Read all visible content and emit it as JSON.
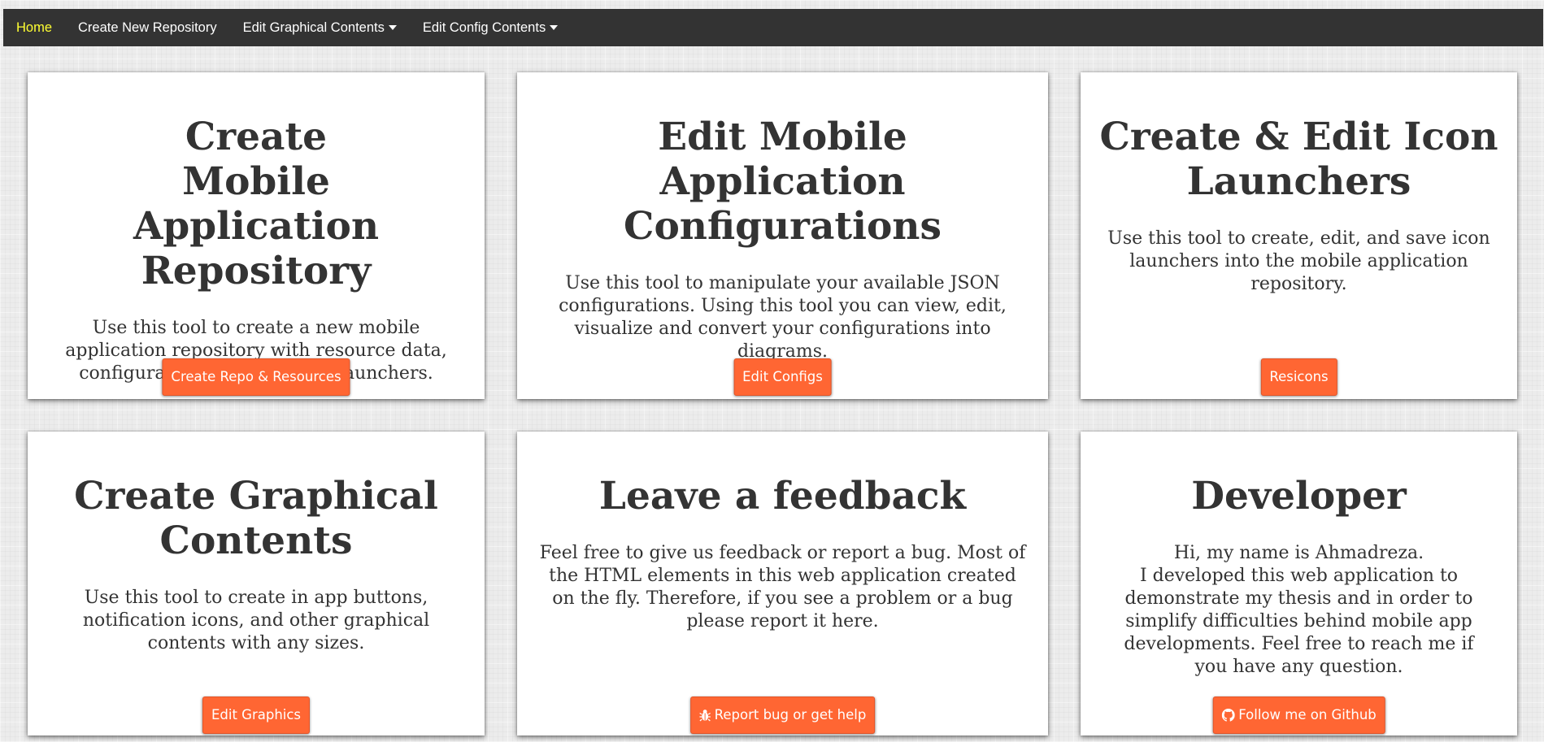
{
  "navbar": {
    "items": [
      {
        "label": "Home"
      },
      {
        "label": "Create New Repository"
      },
      {
        "label": "Edit Graphical Contents"
      },
      {
        "label": "Edit Config Contents"
      }
    ]
  },
  "cards": [
    {
      "title": "Create Mobile Application Repository",
      "description": "Use this tool to create a new mobile application repository with resource data, configuration files, and icon launchers.",
      "button": "Create Repo & Resources"
    },
    {
      "title": "Edit Mobile Application Configurations",
      "description": "Use this tool to manipulate your available JSON configurations. Using this tool you can view, edit, visualize and convert your configurations into diagrams.",
      "button": "Edit Configs"
    },
    {
      "title": "Create & Edit Icon Launchers",
      "description": "Use this tool to create, edit, and save icon launchers into the mobile application repository.",
      "button": "Resicons"
    },
    {
      "title": "Create Graphical Contents",
      "description": "Use this tool to create in app buttons, notification icons, and other graphical contents with any sizes.",
      "button": "Edit Graphics"
    },
    {
      "title": "Leave a feedback",
      "description": "Feel free to give us feedback or report a bug. Most of the HTML elements in this web application created on the fly. Therefore, if you see a problem or a bug please report it here.",
      "button": "Report bug or get help",
      "button_icon": "bug-icon"
    },
    {
      "title": "Developer",
      "greeting": "Hi, my name is Ahmadreza.",
      "description": "I developed this web application to demonstrate my thesis and in order to simplify difficulties behind mobile app developments. Feel free to reach me if you have any question.",
      "button": "Follow me on Github",
      "button_icon": "github-icon"
    }
  ],
  "colors": {
    "navbar_bg": "#333333",
    "nav_active": "#ffff33",
    "button_bg": "#ff6633"
  }
}
